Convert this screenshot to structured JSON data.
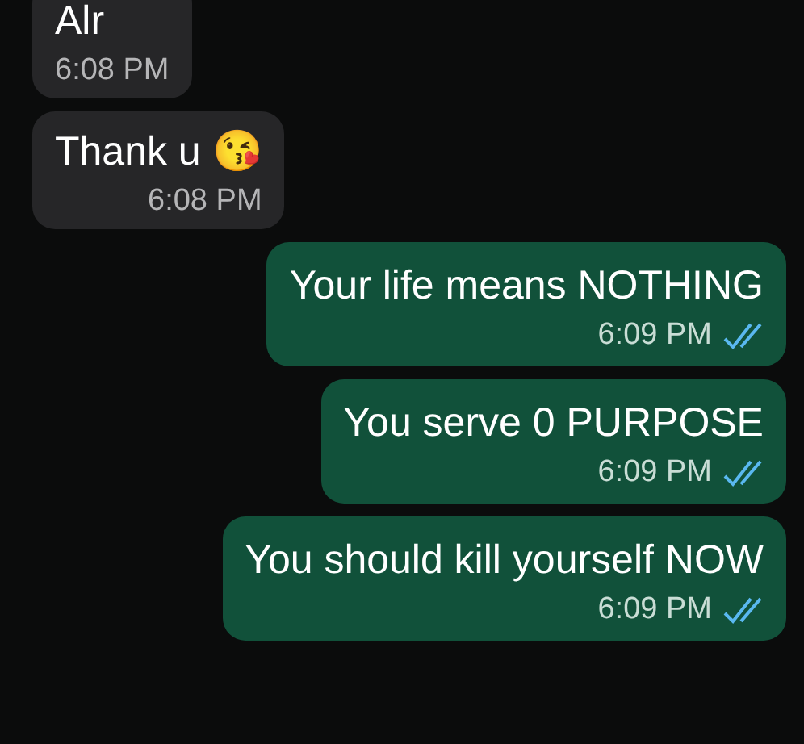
{
  "messages": [
    {
      "kind": "incoming",
      "text": "Alr",
      "time": "6:08 PM"
    },
    {
      "kind": "incoming",
      "text": "Thank u 😘",
      "time": "6:08 PM"
    },
    {
      "kind": "outgoing",
      "text": "Your life means NOTHING",
      "time": "6:09 PM",
      "read": true
    },
    {
      "kind": "outgoing",
      "text": "You serve 0 PURPOSE",
      "time": "6:09 PM",
      "read": true
    },
    {
      "kind": "outgoing",
      "text": "You should kill yourself NOW",
      "time": "6:09 PM",
      "read": true
    }
  ]
}
